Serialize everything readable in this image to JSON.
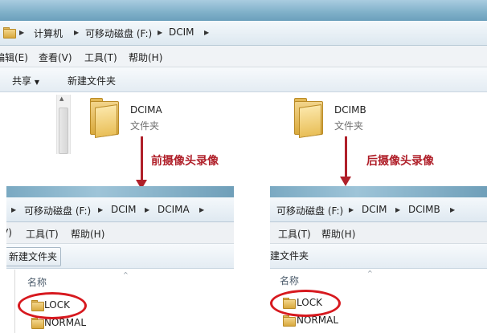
{
  "top": {
    "breadcrumb": [
      "计算机",
      "可移动磁盘 (F:)",
      "DCIM"
    ],
    "menu": [
      "编辑(E)",
      "查看(V)",
      "工具(T)",
      "帮助(H)"
    ],
    "toolbar": {
      "share": "共享",
      "new_folder": "新建文件夹"
    },
    "folders": [
      {
        "name": "DCIMA",
        "type": "文件夹"
      },
      {
        "name": "DCIMB",
        "type": "文件夹"
      }
    ]
  },
  "annotations": {
    "front": "前摄像头录像",
    "rear": "后摄像头录像"
  },
  "left_panel": {
    "breadcrumb": [
      "可移动磁盘 (F:)",
      "DCIM",
      "DCIMA"
    ],
    "menu": [
      "V)",
      "工具(T)",
      "帮助(H)"
    ],
    "new_folder": "新建文件夹",
    "column": "名称",
    "items": [
      "LOCK",
      "NORMAL"
    ]
  },
  "right_panel": {
    "breadcrumb": [
      "可移动磁盘 (F:)",
      "DCIM",
      "DCIMB"
    ],
    "menu": [
      "工具(T)",
      "帮助(H)"
    ],
    "new_folder": "建文件夹",
    "column": "名称",
    "items": [
      "LOCK",
      "NORMAL"
    ]
  },
  "colors": {
    "annotation": "#b0202a",
    "highlight_circle": "#d7191f"
  }
}
